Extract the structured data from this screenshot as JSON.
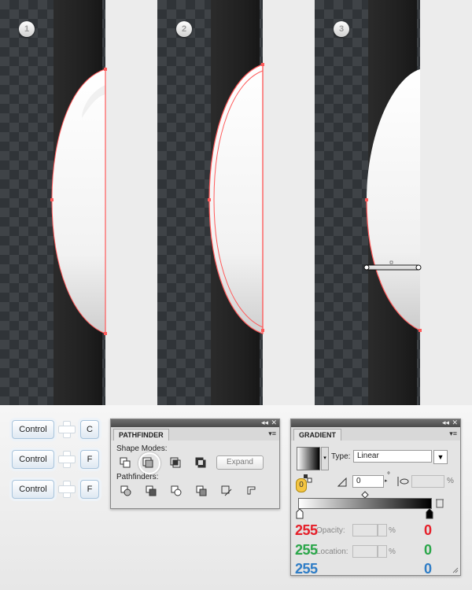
{
  "steps": [
    "1",
    "2",
    "3"
  ],
  "shortcuts": [
    {
      "modifier": "Control",
      "key": "C"
    },
    {
      "modifier": "Control",
      "key": "F"
    },
    {
      "modifier": "Control",
      "key": "F"
    }
  ],
  "pathfinder": {
    "tab": "PATHFINDER",
    "shape_modes_label": "Shape Modes:",
    "pathfinders_label": "Pathfinders:",
    "expand_label": "Expand",
    "shape_mode_icons": [
      "unite-icon",
      "minus-front-icon",
      "intersect-icon",
      "exclude-icon"
    ],
    "pathfinder_icons": [
      "divide-icon",
      "trim-icon",
      "merge-icon",
      "crop-icon",
      "outline-icon",
      "minus-back-icon"
    ]
  },
  "gradient": {
    "tab": "GRADIENT",
    "type_label": "Type:",
    "type_value": "Linear",
    "angle_value": "0",
    "degree_symbol": "°",
    "percent_symbol": "%",
    "opacity_label": "Opacity:",
    "location_label": "Location:",
    "stop_badge": "0"
  },
  "colors": {
    "left": {
      "r": "255",
      "g": "255",
      "b": "255"
    },
    "right": {
      "r": "0",
      "g": "0",
      "b": "0"
    },
    "red": "#e8202a",
    "green": "#2aa84a",
    "blue": "#2f7ec8",
    "path": "#ff5a5a"
  },
  "window_controls": {
    "collapse": "◂◂",
    "close": "✕",
    "menu": "▾≡"
  }
}
